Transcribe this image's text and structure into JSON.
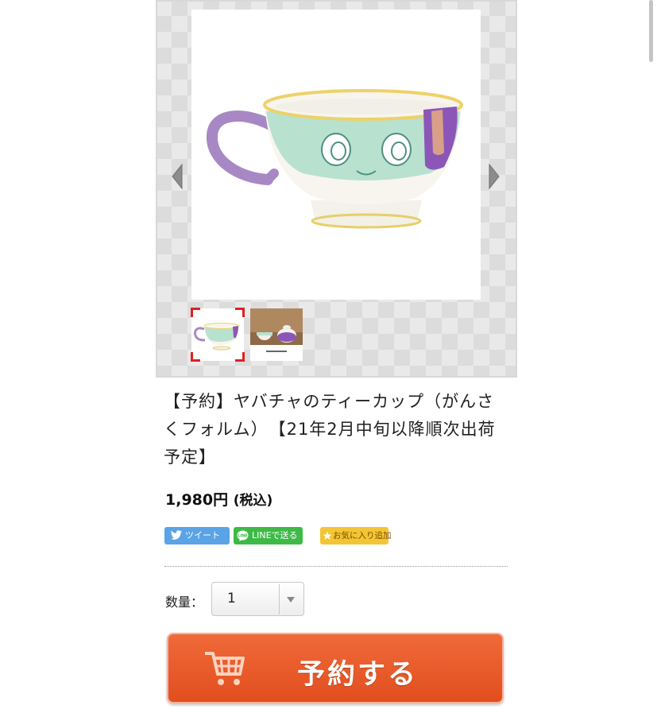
{
  "product": {
    "title": "【予約】ヤバチャのティーカップ（がんさくフォルム）　【21年2月中旬以降順次出荷予定】",
    "price": "1,980円",
    "tax_note": "(税込)"
  },
  "gallery": {
    "main_image": "teacup-product-image",
    "thumbnails": [
      "teacup-thumbnail",
      "teacup-and-teapot-thumbnail"
    ],
    "selected_index": 0
  },
  "share": {
    "tweet_label": "ツイート",
    "line_label": "LINEで送る",
    "favorite_label": "お気に入り追加"
  },
  "quantity": {
    "label": "数量：",
    "value": "1"
  },
  "cta": {
    "label": "予約する"
  },
  "colors": {
    "cta": "#e85a2a",
    "tweet": "#5aa3e6",
    "line": "#3dba46",
    "favorite": "#f3c534",
    "selection": "#dd2222"
  }
}
